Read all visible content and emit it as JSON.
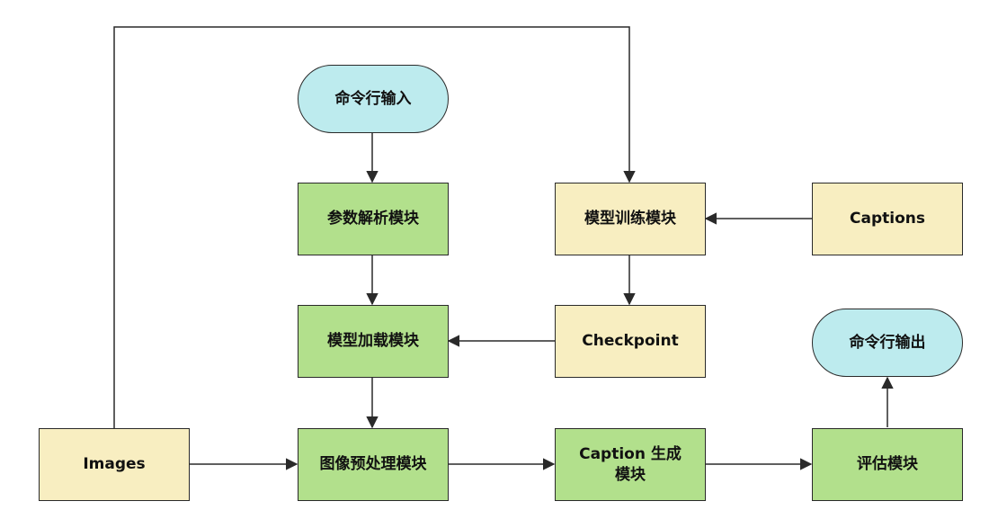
{
  "colors": {
    "process_fill": "#b2e08c",
    "data_fill": "#f8eec1",
    "terminal_fill": "#bdebee",
    "stroke": "#2a2a2a"
  },
  "nodes": {
    "cmd_input": "命令行输入",
    "arg_parse": "参数解析模块",
    "model_load": "模型加载模块",
    "image_preprocess": "图像预处理模块",
    "caption_gen": "Caption 生成\n模块",
    "evaluate": "评估模块",
    "cmd_output": "命令行输出",
    "model_train": "模型训练模块",
    "checkpoint": "Checkpoint",
    "captions": "Captions",
    "images": "Images"
  },
  "edges": [
    {
      "from": "cmd_input",
      "to": "arg_parse"
    },
    {
      "from": "arg_parse",
      "to": "model_load"
    },
    {
      "from": "model_load",
      "to": "image_preprocess"
    },
    {
      "from": "images",
      "to": "image_preprocess"
    },
    {
      "from": "image_preprocess",
      "to": "caption_gen"
    },
    {
      "from": "caption_gen",
      "to": "evaluate"
    },
    {
      "from": "evaluate",
      "to": "cmd_output"
    },
    {
      "from": "captions",
      "to": "model_train"
    },
    {
      "from": "model_train",
      "to": "checkpoint"
    },
    {
      "from": "checkpoint",
      "to": "model_load"
    },
    {
      "from": "images",
      "to": "model_train"
    }
  ]
}
